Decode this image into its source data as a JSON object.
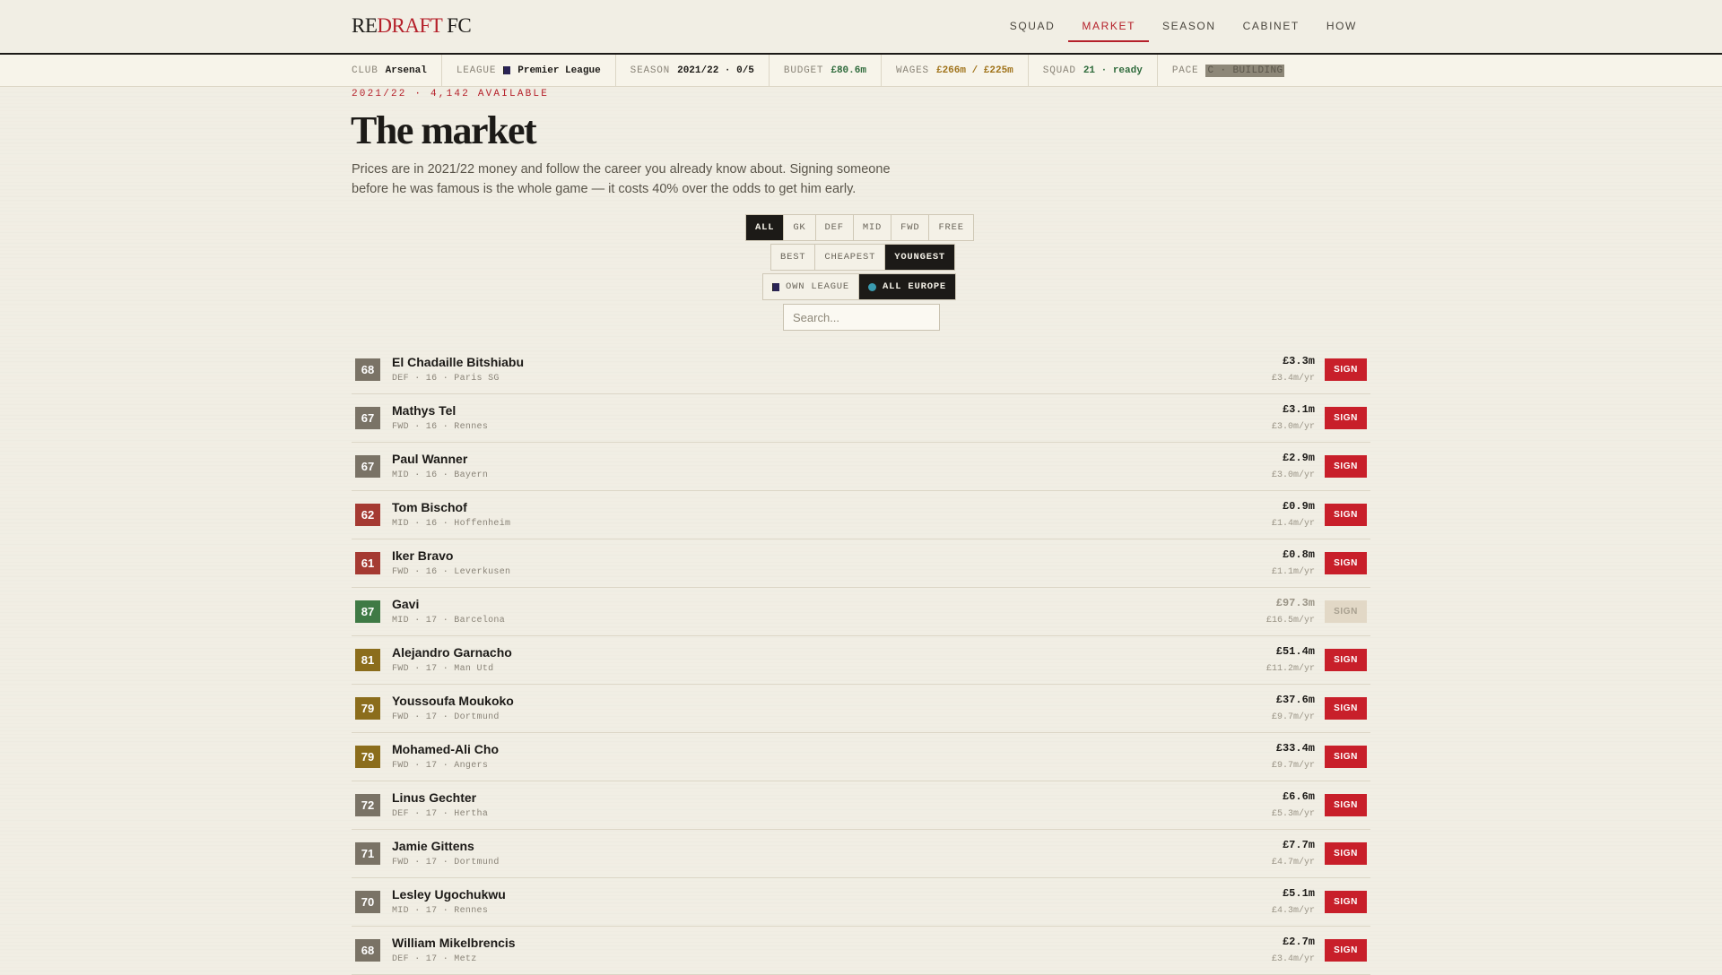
{
  "logo": {
    "part1": "RE",
    "part2": "DRAFT",
    "part3": " FC"
  },
  "nav": [
    {
      "label": "SQUAD",
      "active": false
    },
    {
      "label": "MARKET",
      "active": true
    },
    {
      "label": "SEASON",
      "active": false
    },
    {
      "label": "CABINET",
      "active": false
    },
    {
      "label": "HOW",
      "active": false
    }
  ],
  "status": {
    "club_label": "CLUB",
    "club": "Arsenal",
    "league_label": "LEAGUE",
    "league": "Premier League",
    "season_label": "SEASON",
    "season": "2021/22 · 0/5",
    "budget_label": "BUDGET",
    "budget": "£80.6m",
    "wages_label": "WAGES",
    "wages": "£266m / £225m",
    "squad_label": "SQUAD",
    "squad": "21 · ready",
    "pace_label": "PACE",
    "pace": "C · BUILDING"
  },
  "header": {
    "eyebrow": "2021/22 · 4,142 AVAILABLE",
    "title": "The market",
    "intro": "Prices are in 2021/22 money and follow the career you already know about. Signing someone before he was famous is the whole game — it costs 40% over the odds to get him early."
  },
  "filters": {
    "position": [
      {
        "label": "ALL",
        "active": true
      },
      {
        "label": "GK",
        "active": false
      },
      {
        "label": "DEF",
        "active": false
      },
      {
        "label": "MID",
        "active": false
      },
      {
        "label": "FWD",
        "active": false
      },
      {
        "label": "FREE",
        "active": false
      }
    ],
    "sort": [
      {
        "label": "BEST",
        "active": false
      },
      {
        "label": "CHEAPEST",
        "active": false
      },
      {
        "label": "YOUNGEST",
        "active": true
      }
    ],
    "scope": [
      {
        "label": "OWN LEAGUE",
        "icon": "flag-icon",
        "active": false
      },
      {
        "label": "ALL EUROPE",
        "icon": "globe-icon",
        "active": true
      }
    ],
    "search_placeholder": "Search..."
  },
  "rating_colors": {
    "grey": "#7a7366",
    "red": "#a53a32",
    "green": "#3f7a45",
    "gold": "#8b6d1c"
  },
  "sign_label": "SIGN",
  "players": [
    {
      "rating": "68",
      "tier": "grey",
      "name": "El Chadaille Bitshiabu",
      "meta": "DEF · 16 · Paris SG",
      "price": "£3.3m",
      "wage": "£3.4m/yr",
      "affordable": true
    },
    {
      "rating": "67",
      "tier": "grey",
      "name": "Mathys Tel",
      "meta": "FWD · 16 · Rennes",
      "price": "£3.1m",
      "wage": "£3.0m/yr",
      "affordable": true
    },
    {
      "rating": "67",
      "tier": "grey",
      "name": "Paul Wanner",
      "meta": "MID · 16 · Bayern",
      "price": "£2.9m",
      "wage": "£3.0m/yr",
      "affordable": true
    },
    {
      "rating": "62",
      "tier": "red",
      "name": "Tom Bischof",
      "meta": "MID · 16 · Hoffenheim",
      "price": "£0.9m",
      "wage": "£1.4m/yr",
      "affordable": true
    },
    {
      "rating": "61",
      "tier": "red",
      "name": "Iker Bravo",
      "meta": "FWD · 16 · Leverkusen",
      "price": "£0.8m",
      "wage": "£1.1m/yr",
      "affordable": true
    },
    {
      "rating": "87",
      "tier": "green",
      "name": "Gavi",
      "meta": "MID · 17 · Barcelona",
      "price": "£97.3m",
      "wage": "£16.5m/yr",
      "affordable": false
    },
    {
      "rating": "81",
      "tier": "gold",
      "name": "Alejandro Garnacho",
      "meta": "FWD · 17 · Man Utd",
      "price": "£51.4m",
      "wage": "£11.2m/yr",
      "affordable": true
    },
    {
      "rating": "79",
      "tier": "gold",
      "name": "Youssoufa Moukoko",
      "meta": "FWD · 17 · Dortmund",
      "price": "£37.6m",
      "wage": "£9.7m/yr",
      "affordable": true
    },
    {
      "rating": "79",
      "tier": "gold",
      "name": "Mohamed-Ali Cho",
      "meta": "FWD · 17 · Angers",
      "price": "£33.4m",
      "wage": "£9.7m/yr",
      "affordable": true
    },
    {
      "rating": "72",
      "tier": "grey",
      "name": "Linus Gechter",
      "meta": "DEF · 17 · Hertha",
      "price": "£6.6m",
      "wage": "£5.3m/yr",
      "affordable": true
    },
    {
      "rating": "71",
      "tier": "grey",
      "name": "Jamie Gittens",
      "meta": "FWD · 17 · Dortmund",
      "price": "£7.7m",
      "wage": "£4.7m/yr",
      "affordable": true
    },
    {
      "rating": "70",
      "tier": "grey",
      "name": "Lesley Ugochukwu",
      "meta": "MID · 17 · Rennes",
      "price": "£5.1m",
      "wage": "£4.3m/yr",
      "affordable": true
    },
    {
      "rating": "68",
      "tier": "grey",
      "name": "William Mikelbrencis",
      "meta": "DEF · 17 · Metz",
      "price": "£2.7m",
      "wage": "£3.4m/yr",
      "affordable": true
    }
  ]
}
